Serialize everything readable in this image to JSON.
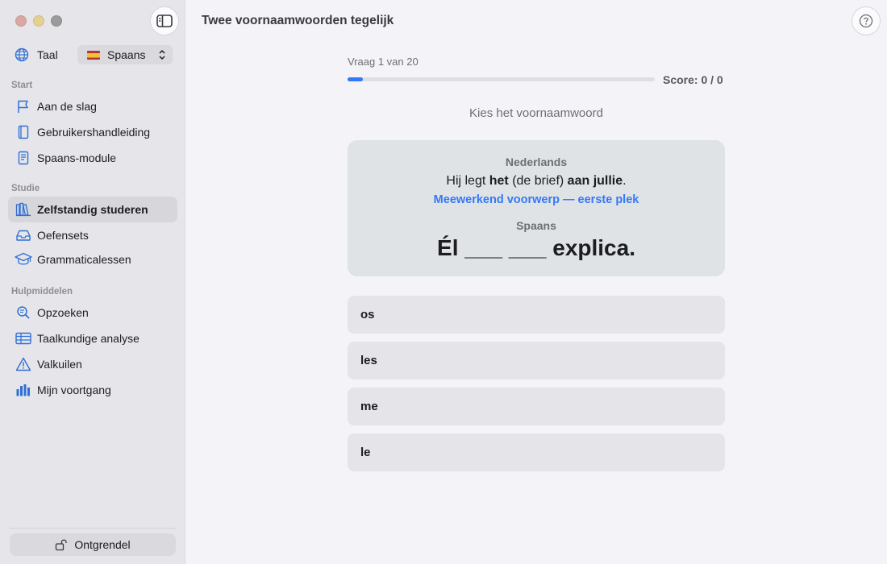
{
  "sidebar": {
    "language_label": "Taal",
    "language_value": "Spaans",
    "sections": {
      "start": "Start",
      "studie": "Studie",
      "hulpmiddelen": "Hulpmiddelen"
    },
    "items": [
      {
        "label": "Aan de slag",
        "icon": "flag-icon"
      },
      {
        "label": "Gebruikershandleiding",
        "icon": "book-icon"
      },
      {
        "label": "Spaans-module",
        "icon": "document-icon"
      },
      {
        "label": "Zelfstandig studeren",
        "icon": "books-icon",
        "active": true
      },
      {
        "label": "Oefensets",
        "icon": "tray-icon"
      },
      {
        "label": "Grammaticalessen",
        "icon": "graduation-cap-icon"
      },
      {
        "label": "Opzoeken",
        "icon": "search-icon"
      },
      {
        "label": "Taalkundige analyse",
        "icon": "table-icon"
      },
      {
        "label": "Valkuilen",
        "icon": "warning-icon"
      },
      {
        "label": "Mijn voortgang",
        "icon": "bar-chart-icon"
      }
    ],
    "unlock_label": "Ontgrendel"
  },
  "header": {
    "title": "Twee voornaamwoorden tegelijk"
  },
  "quiz": {
    "question_counter": "Vraag 1 van 20",
    "progress_fraction": 0.05,
    "score": "Score: 0 / 0",
    "instruction": "Kies het voornaamwoord",
    "source_language": "Nederlands",
    "source_sentence": {
      "part1": "Hij legt ",
      "bold1": "het",
      "part2": " (de brief) ",
      "bold2": "aan jullie",
      "part3": "."
    },
    "hint": "Meewerkend voorwerp — eerste plek",
    "target_language": "Spaans",
    "target_sentence": "Él ___ ___ explica.",
    "options": [
      "os",
      "les",
      "me",
      "le"
    ]
  },
  "colors": {
    "accent": "#3478f6",
    "sidebar_bg": "#e6e6ea",
    "card_bg": "#dfe3e6"
  }
}
